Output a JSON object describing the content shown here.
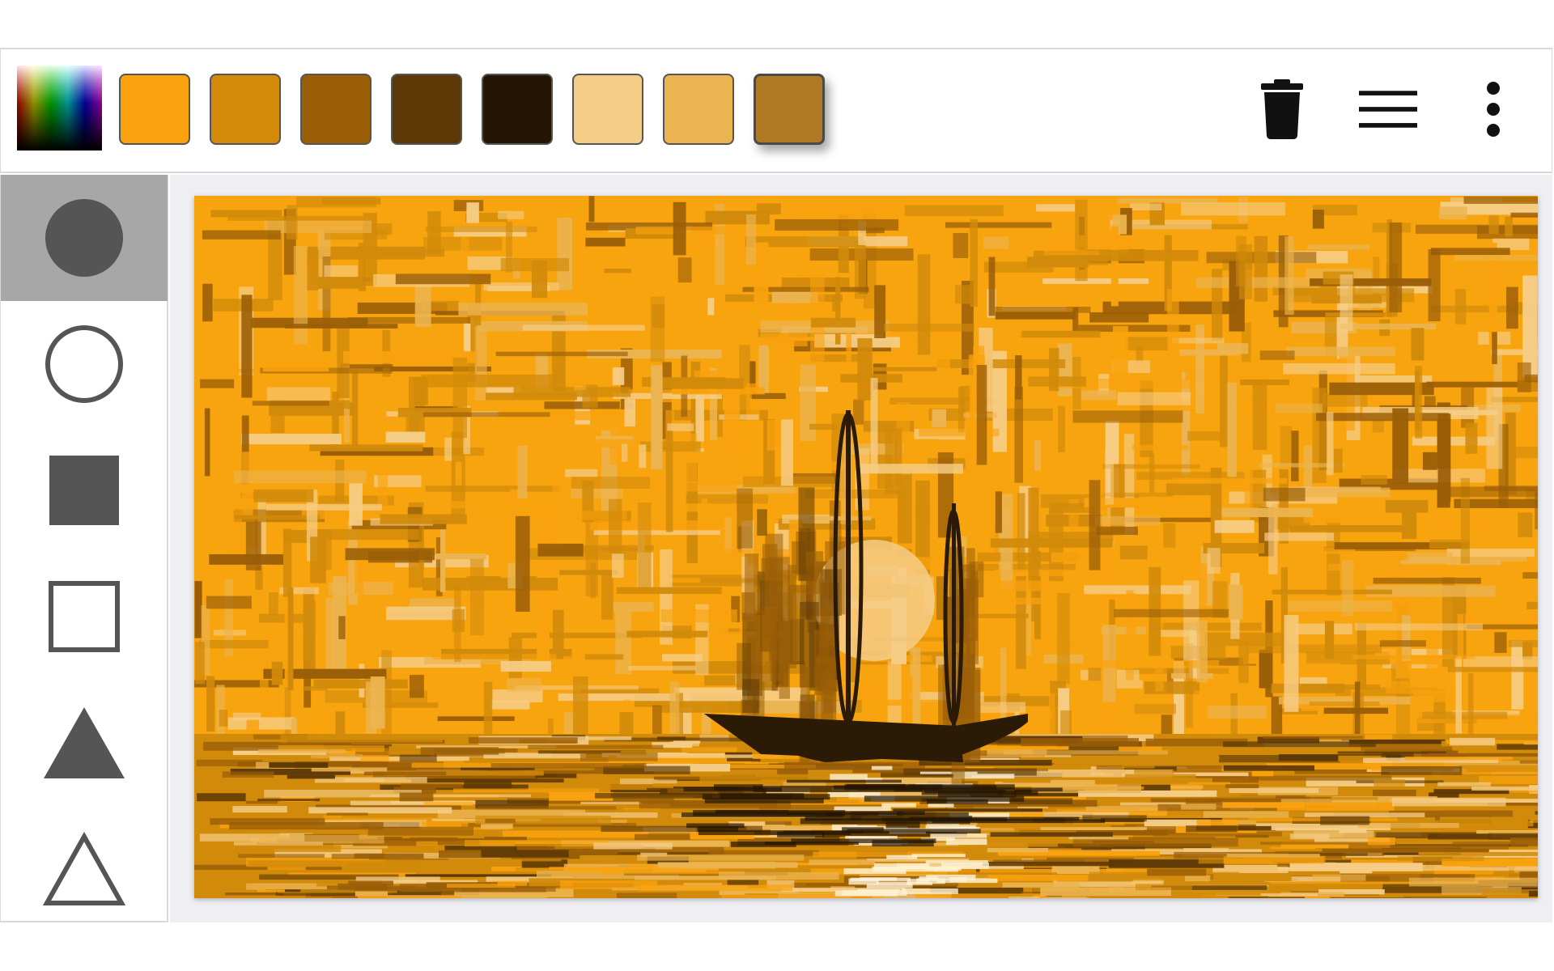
{
  "palette": {
    "spectrum_icon": "color-spectrum-icon",
    "swatches": [
      {
        "color": "#f9a20e",
        "selected": false
      },
      {
        "color": "#d18a0a",
        "selected": false
      },
      {
        "color": "#9a5e07",
        "selected": false
      },
      {
        "color": "#5c3806",
        "selected": false
      },
      {
        "color": "#241504",
        "selected": false
      },
      {
        "color": "#f6cd86",
        "selected": false
      },
      {
        "color": "#ecb450",
        "selected": false
      },
      {
        "color": "#b07a25",
        "selected": true
      }
    ]
  },
  "toolbar": {
    "actions": [
      {
        "name": "trash-icon"
      },
      {
        "name": "menu-icon"
      },
      {
        "name": "more-vertical-icon"
      }
    ]
  },
  "tools": [
    {
      "name": "filled-circle",
      "active": true
    },
    {
      "name": "outline-circle",
      "active": false
    },
    {
      "name": "filled-square",
      "active": false
    },
    {
      "name": "outline-square",
      "active": false
    },
    {
      "name": "filled-triangle",
      "active": false
    },
    {
      "name": "outline-triangle",
      "active": false
    }
  ],
  "colors": {
    "tool_gray": "#555555",
    "active_tool_bg": "#a7a7a7",
    "canvas_bg": "#eeeef3",
    "sky": "#f7a40f",
    "silhouette": "#2a1a06"
  },
  "canvas": {
    "subject": "sailboat-silhouette-at-sunset"
  }
}
